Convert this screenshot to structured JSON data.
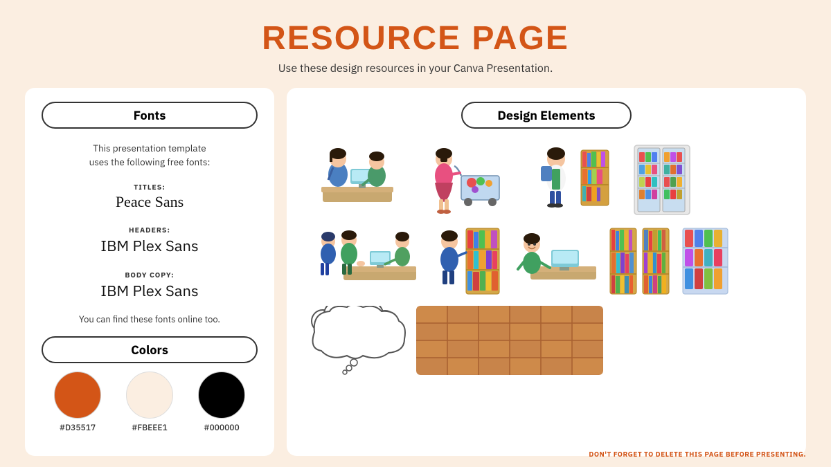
{
  "page": {
    "title": "RESOURCE PAGE",
    "subtitle": "Use these design resources in your Canva Presentation.",
    "footer_note": "Don't forget to delete this page before presenting."
  },
  "left_panel": {
    "fonts_section": {
      "header": "Fonts",
      "description": "This presentation template\nuses the following free fonts:",
      "title_label": "TITLES:",
      "title_font": "Peace Sans",
      "headers_label": "HEADERS:",
      "headers_font": "IBM Plex Sans",
      "body_label": "BODY COPY:",
      "body_font": "IBM Plex Sans",
      "note": "You can find these fonts online too."
    },
    "colors_section": {
      "header": "Colors",
      "swatches": [
        {
          "hex": "#D35517",
          "label": "#D35517"
        },
        {
          "hex": "#FBEEE1",
          "label": "#FBEEE1"
        },
        {
          "hex": "#000000",
          "label": "#000000"
        }
      ]
    }
  },
  "right_panel": {
    "header": "Design Elements"
  }
}
